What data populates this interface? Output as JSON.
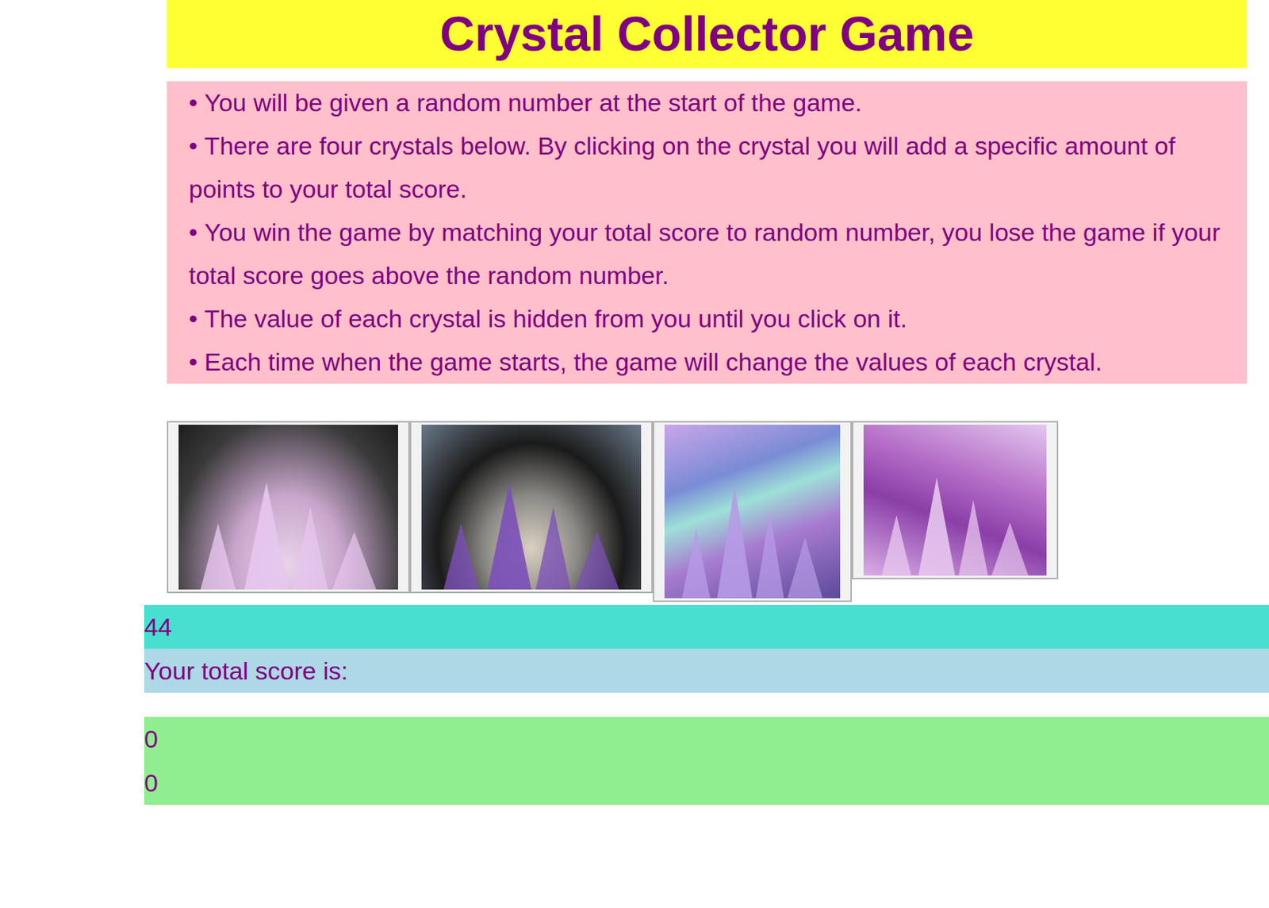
{
  "title": "Crystal Collector Game",
  "instructions": [
    "You will be given a random number at the start of the game.",
    "There are four crystals below. By clicking on the crystal you will add a specific amount of points to your total score.",
    "You win the game by matching your total score to random number, you lose the game if your total score goes above the random number.",
    "The value of each crystal is hidden from you until you click on it.",
    "Each time when the game starts, the game will change the values of each crystal."
  ],
  "crystals": [
    {
      "kind": "cluster"
    },
    {
      "kind": "point"
    },
    {
      "kind": "holo"
    },
    {
      "kind": "amethyst"
    }
  ],
  "target": "44",
  "score_label": "Your total score is:",
  "score_values": [
    "0",
    "0"
  ]
}
